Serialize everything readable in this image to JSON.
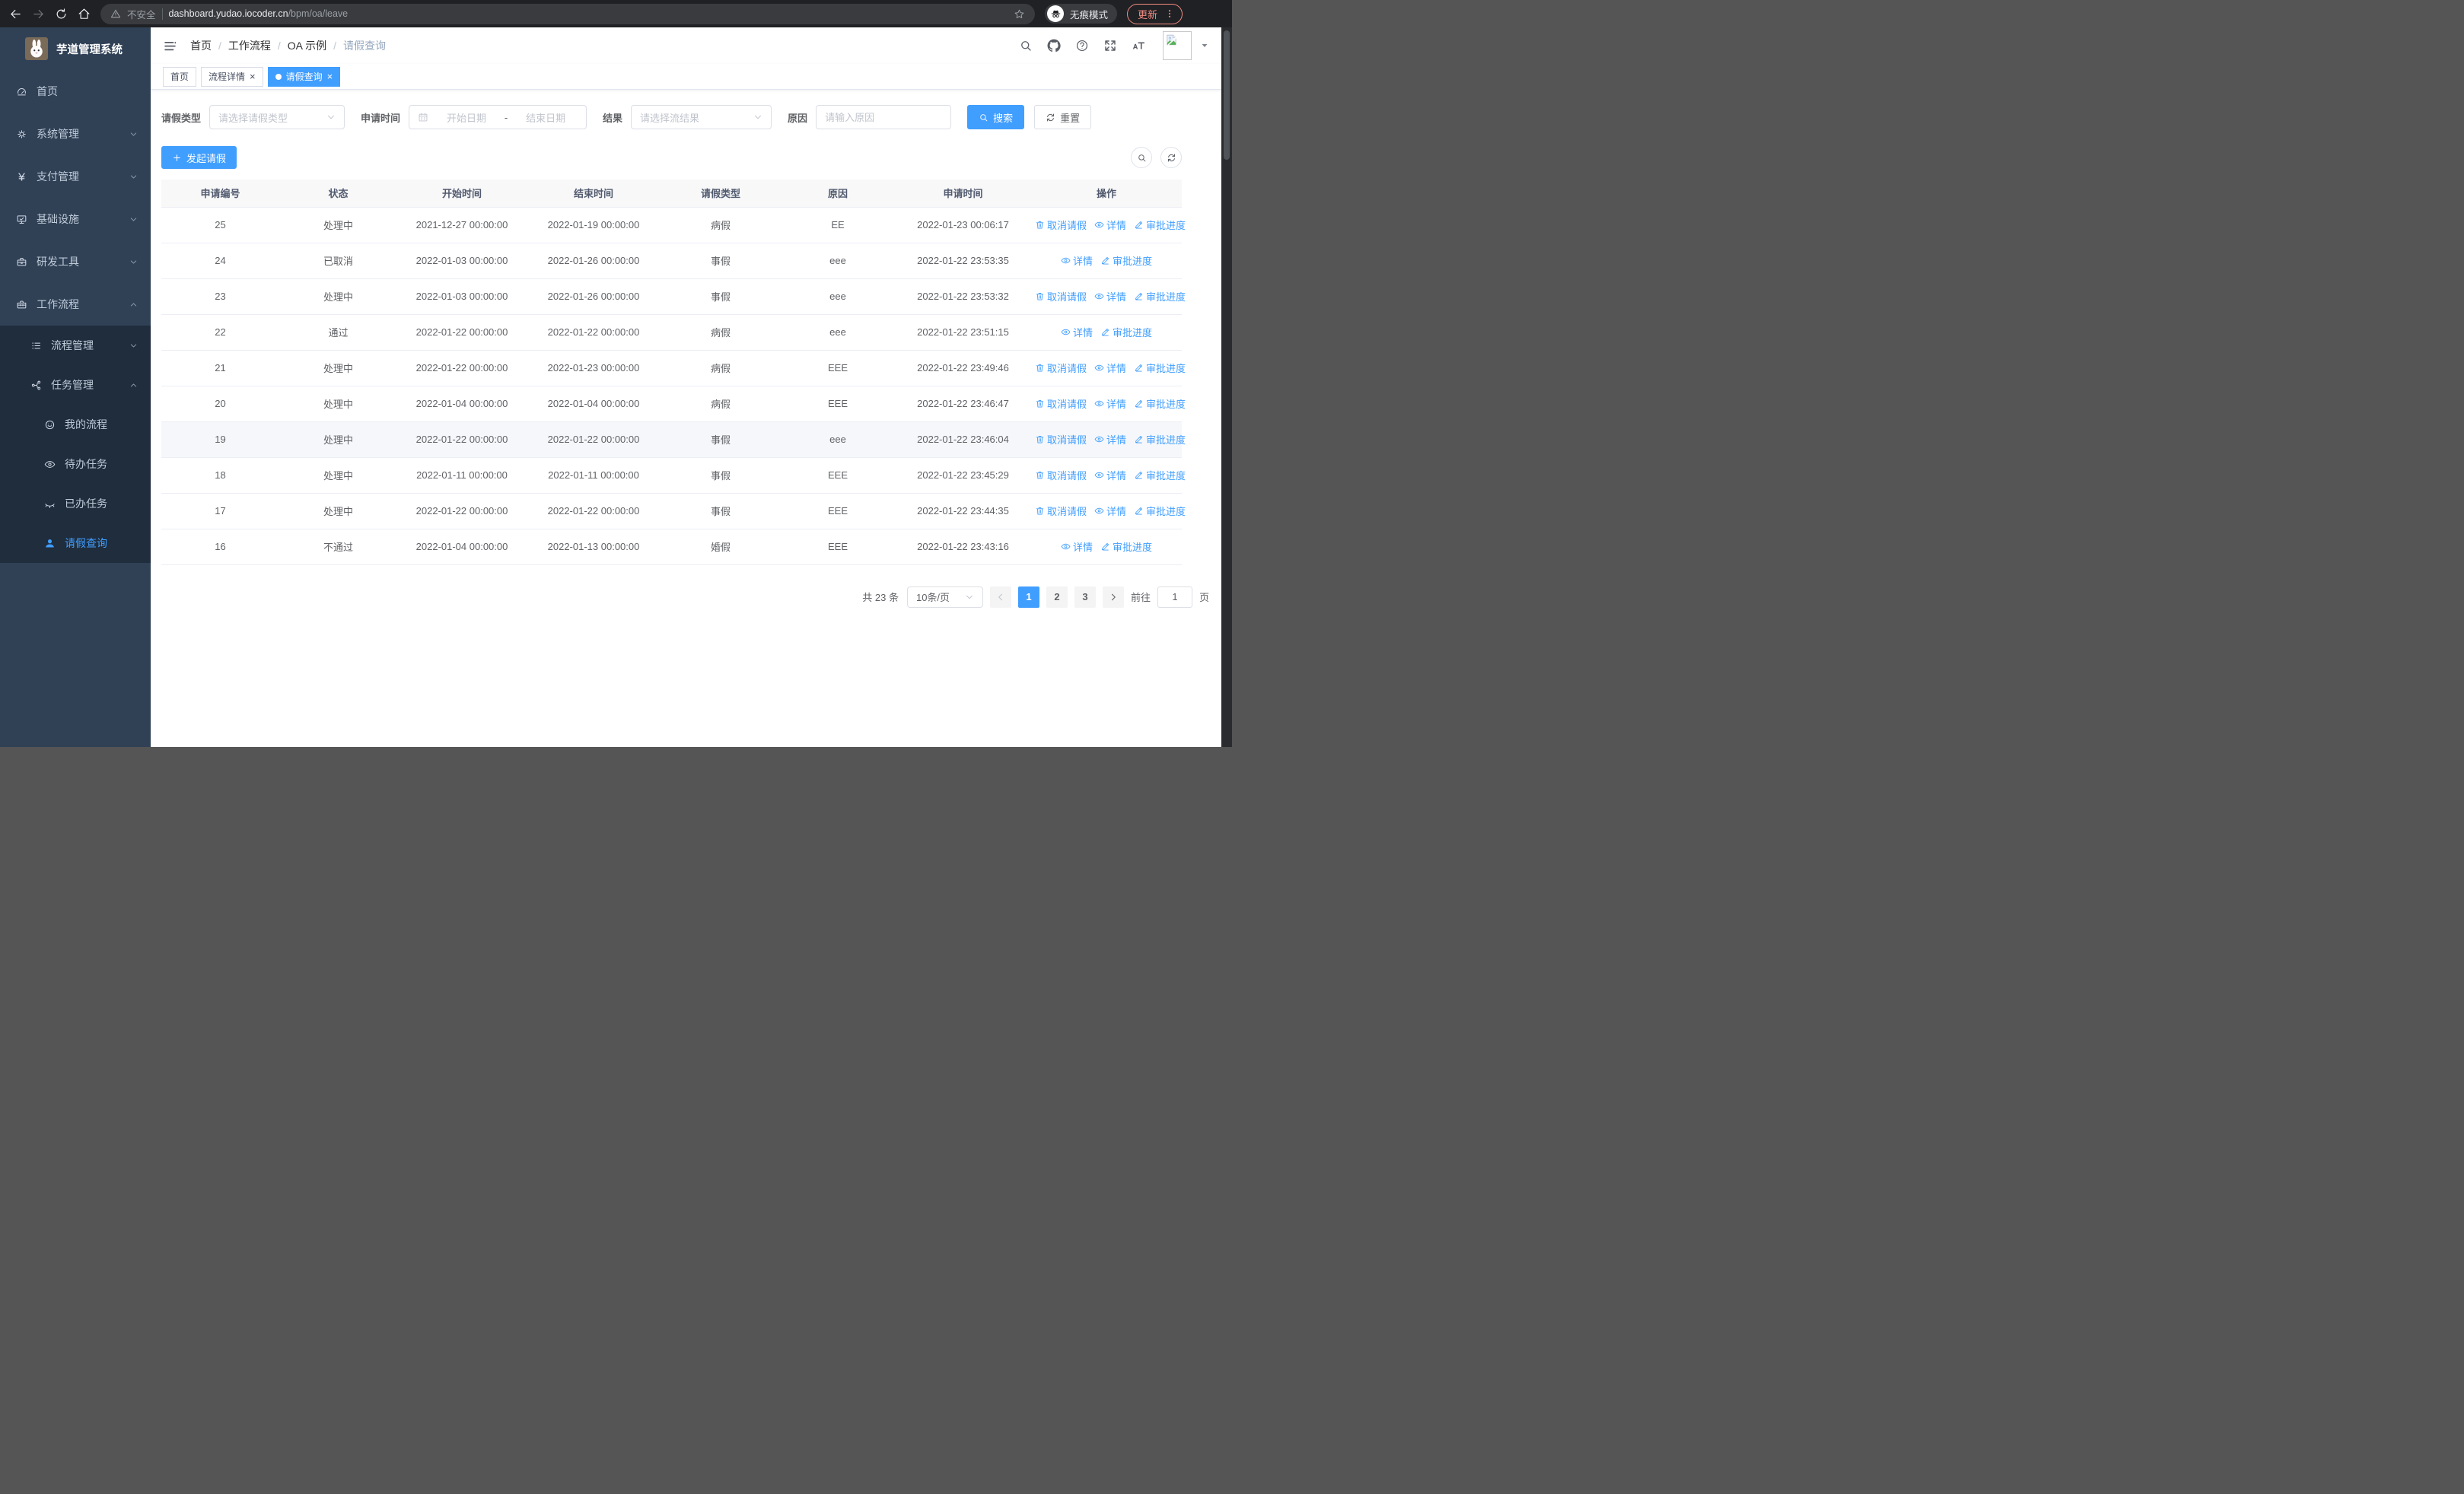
{
  "browser": {
    "security_label": "不安全",
    "url_host": "dashboard.yudao.iocoder.cn",
    "url_path": "/bpm/oa/leave",
    "incognito_label": "无痕模式",
    "update_label": "更新"
  },
  "sidebar": {
    "title": "芋道管理系统",
    "items": [
      {
        "id": "home",
        "icon": "dashboard-icon",
        "label": "首页",
        "level": 1
      },
      {
        "id": "system",
        "icon": "gear-icon",
        "label": "系统管理",
        "level": 1,
        "arrow": "down"
      },
      {
        "id": "payment",
        "icon": "yen-icon",
        "label": "支付管理",
        "level": 1,
        "arrow": "down"
      },
      {
        "id": "infra",
        "icon": "monitor-icon",
        "label": "基础设施",
        "level": 1,
        "arrow": "down"
      },
      {
        "id": "devtools",
        "icon": "toolbox-icon",
        "label": "研发工具",
        "level": 1,
        "arrow": "down"
      },
      {
        "id": "workflow",
        "icon": "suitcase-icon",
        "label": "工作流程",
        "level": 1,
        "arrow": "up"
      },
      {
        "id": "process-mgmt",
        "icon": "tree-list-icon",
        "label": "流程管理",
        "level": 2,
        "arrow": "down"
      },
      {
        "id": "task-mgmt",
        "icon": "flow-icon",
        "label": "任务管理",
        "level": 2,
        "arrow": "up"
      },
      {
        "id": "my-process",
        "icon": "face-icon",
        "label": "我的流程",
        "level": 3
      },
      {
        "id": "todo-task",
        "icon": "eye-open-icon",
        "label": "待办任务",
        "level": 3
      },
      {
        "id": "done-task",
        "icon": "eye-closed-icon",
        "label": "已办任务",
        "level": 3
      },
      {
        "id": "leave-query",
        "icon": "user-icon",
        "label": "请假查询",
        "level": 3,
        "active": true
      }
    ]
  },
  "breadcrumb": {
    "items": [
      "首页",
      "工作流程",
      "OA 示例",
      "请假查询"
    ]
  },
  "tabs": [
    {
      "id": "home",
      "label": "首页",
      "active": false,
      "closable": false
    },
    {
      "id": "process-detail",
      "label": "流程详情",
      "active": false,
      "closable": true
    },
    {
      "id": "leave-query",
      "label": "请假查询",
      "active": true,
      "closable": true
    }
  ],
  "filters": {
    "type_label": "请假类型",
    "type_placeholder": "请选择请假类型",
    "time_label": "申请时间",
    "start_placeholder": "开始日期",
    "range_separator": "-",
    "end_placeholder": "结束日期",
    "result_label": "结果",
    "result_placeholder": "请选择流结果",
    "reason_label": "原因",
    "reason_placeholder": "请输入原因",
    "search_label": "搜索",
    "reset_label": "重置"
  },
  "toolbar": {
    "create_label": "发起请假"
  },
  "table": {
    "columns": [
      "申请编号",
      "状态",
      "开始时间",
      "结束时间",
      "请假类型",
      "原因",
      "申请时间",
      "操作"
    ],
    "actions": {
      "cancel": "取消请假",
      "detail": "详情",
      "progress": "审批进度"
    },
    "rows": [
      {
        "id": "25",
        "status": "处理中",
        "start": "2021-12-27 00:00:00",
        "end": "2022-01-19 00:00:00",
        "type": "病假",
        "reason": "EE",
        "apply_time": "2022-01-23 00:06:17",
        "actions": [
          "cancel",
          "detail",
          "progress"
        ],
        "highlight": false
      },
      {
        "id": "24",
        "status": "已取消",
        "start": "2022-01-03 00:00:00",
        "end": "2022-01-26 00:00:00",
        "type": "事假",
        "reason": "eee",
        "apply_time": "2022-01-22 23:53:35",
        "actions": [
          "detail",
          "progress"
        ],
        "highlight": false
      },
      {
        "id": "23",
        "status": "处理中",
        "start": "2022-01-03 00:00:00",
        "end": "2022-01-26 00:00:00",
        "type": "事假",
        "reason": "eee",
        "apply_time": "2022-01-22 23:53:32",
        "actions": [
          "cancel",
          "detail",
          "progress"
        ],
        "highlight": false
      },
      {
        "id": "22",
        "status": "通过",
        "start": "2022-01-22 00:00:00",
        "end": "2022-01-22 00:00:00",
        "type": "病假",
        "reason": "eee",
        "apply_time": "2022-01-22 23:51:15",
        "actions": [
          "detail",
          "progress"
        ],
        "highlight": false
      },
      {
        "id": "21",
        "status": "处理中",
        "start": "2022-01-22 00:00:00",
        "end": "2022-01-23 00:00:00",
        "type": "病假",
        "reason": "EEE",
        "apply_time": "2022-01-22 23:49:46",
        "actions": [
          "cancel",
          "detail",
          "progress"
        ],
        "highlight": false
      },
      {
        "id": "20",
        "status": "处理中",
        "start": "2022-01-04 00:00:00",
        "end": "2022-01-04 00:00:00",
        "type": "病假",
        "reason": "EEE",
        "apply_time": "2022-01-22 23:46:47",
        "actions": [
          "cancel",
          "detail",
          "progress"
        ],
        "highlight": false
      },
      {
        "id": "19",
        "status": "处理中",
        "start": "2022-01-22 00:00:00",
        "end": "2022-01-22 00:00:00",
        "type": "事假",
        "reason": "eee",
        "apply_time": "2022-01-22 23:46:04",
        "actions": [
          "cancel",
          "detail",
          "progress"
        ],
        "highlight": true
      },
      {
        "id": "18",
        "status": "处理中",
        "start": "2022-01-11 00:00:00",
        "end": "2022-01-11 00:00:00",
        "type": "事假",
        "reason": "EEE",
        "apply_time": "2022-01-22 23:45:29",
        "actions": [
          "cancel",
          "detail",
          "progress"
        ],
        "highlight": false
      },
      {
        "id": "17",
        "status": "处理中",
        "start": "2022-01-22 00:00:00",
        "end": "2022-01-22 00:00:00",
        "type": "事假",
        "reason": "EEE",
        "apply_time": "2022-01-22 23:44:35",
        "actions": [
          "cancel",
          "detail",
          "progress"
        ],
        "highlight": false
      },
      {
        "id": "16",
        "status": "不通过",
        "start": "2022-01-04 00:00:00",
        "end": "2022-01-13 00:00:00",
        "type": "婚假",
        "reason": "EEE",
        "apply_time": "2022-01-22 23:43:16",
        "actions": [
          "detail",
          "progress"
        ],
        "highlight": false
      }
    ]
  },
  "pagination": {
    "total_label": "共 23 条",
    "page_size_label": "10条/页",
    "pages": [
      "1",
      "2",
      "3"
    ],
    "active_page": "1",
    "goto_label": "前往",
    "goto_value": "1",
    "page_suffix": "页"
  },
  "colors": {
    "accent_blue": "#409eff",
    "sidebar_bg": "#304156",
    "submenu_bg": "#1f2d3d",
    "sidebar_text": "#bfcbd9",
    "browser_bar_bg": "#202124",
    "update_chip": "#f28b82",
    "table_border": "#ebeef5",
    "header_row_bg": "#f8f8f9",
    "highlight_row_bg": "#f5f7fa"
  }
}
